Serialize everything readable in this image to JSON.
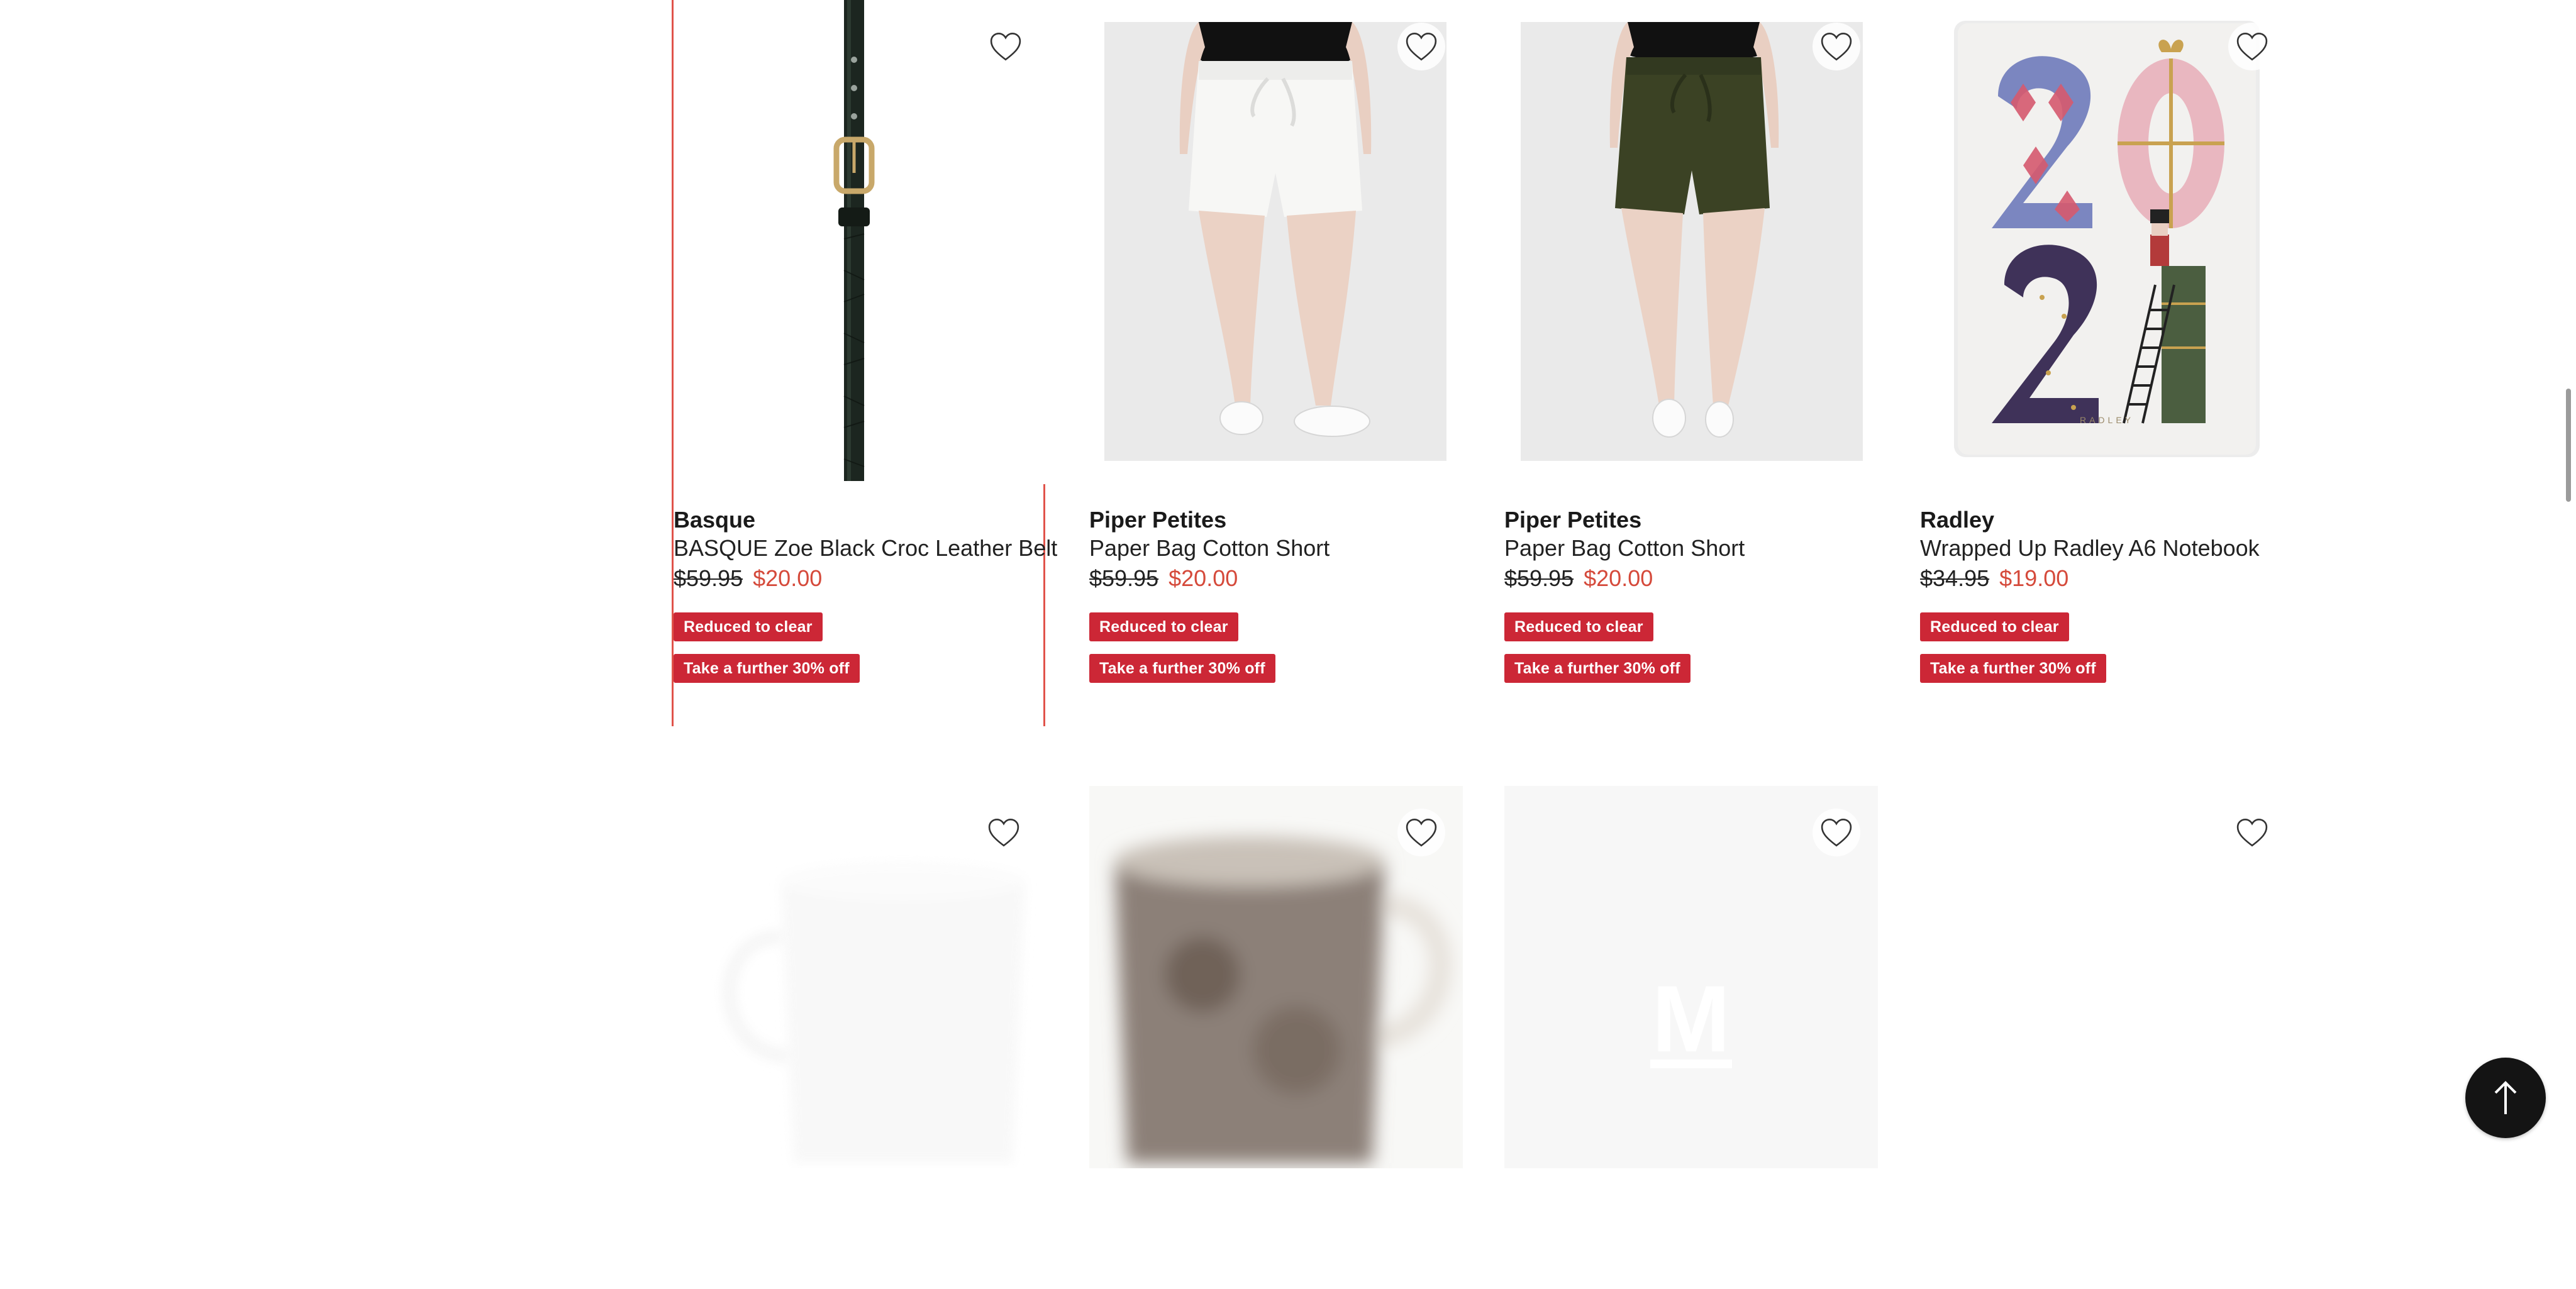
{
  "products": [
    {
      "brand": "Basque",
      "name": "BASQUE Zoe Black Croc Leather Belt",
      "was_price": "$59.95",
      "now_price": "$20.00",
      "badges": [
        "Reduced to clear",
        "Take a further 30% off"
      ]
    },
    {
      "brand": "Piper Petites",
      "name": "Paper Bag Cotton Short",
      "was_price": "$59.95",
      "now_price": "$20.00",
      "badges": [
        "Reduced to clear",
        "Take a further 30% off"
      ]
    },
    {
      "brand": "Piper Petites",
      "name": "Paper Bag Cotton Short",
      "was_price": "$59.95",
      "now_price": "$20.00",
      "badges": [
        "Reduced to clear",
        "Take a further 30% off"
      ]
    },
    {
      "brand": "Radley",
      "name": "Wrapped Up Radley A6 Notebook",
      "was_price": "$34.95",
      "now_price": "$19.00",
      "badges": [
        "Reduced to clear",
        "Take a further 30% off"
      ]
    }
  ],
  "placeholder_logo": "M",
  "colors": {
    "badge": "#cc2736",
    "sale_price": "#d54a3b",
    "selection_border": "#e0534a",
    "back_to_top": "#141414"
  },
  "icons": {
    "wishlist": "heart-outline-icon",
    "back_to_top": "arrow-up-icon"
  }
}
